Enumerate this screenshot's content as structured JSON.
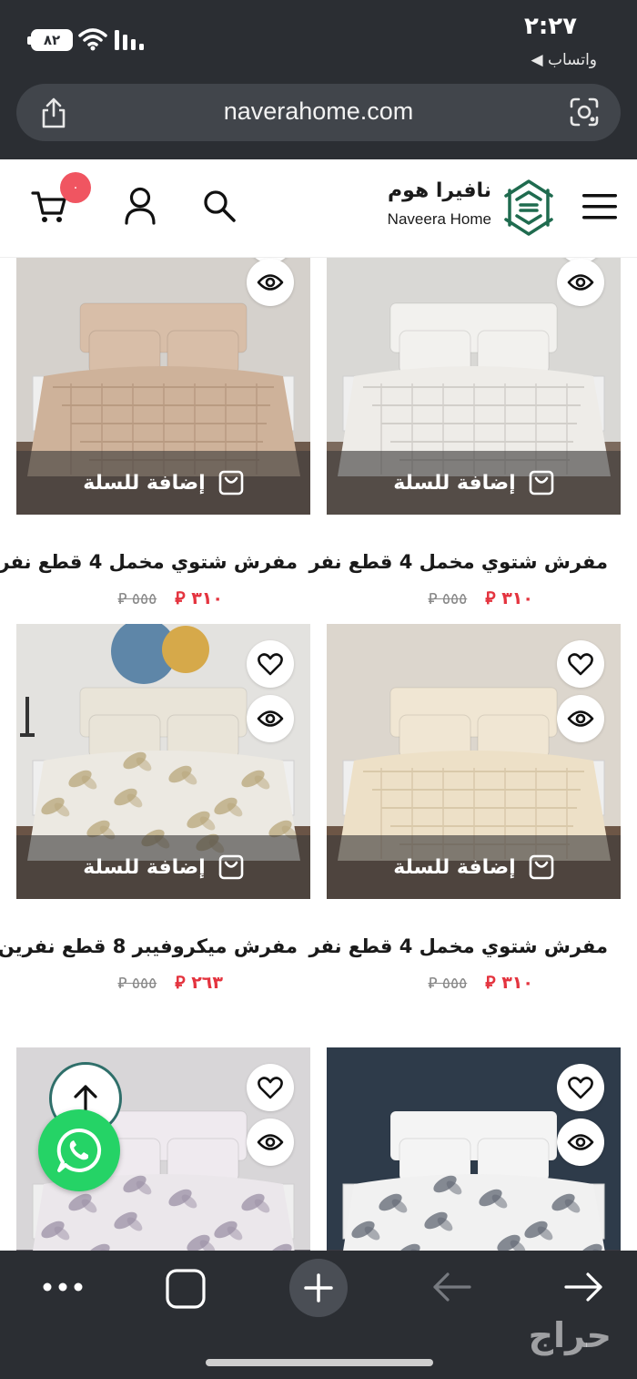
{
  "status_bar": {
    "time": "٢:٢٧",
    "back_app": "◀ واتساب",
    "battery": "٨٢"
  },
  "browser": {
    "url": "naverahome.com"
  },
  "header": {
    "logo_arabic": "نافيرا هوم",
    "logo_english": "Naveera Home",
    "cart_count": "٠"
  },
  "product_actions": {
    "add_to_cart": "إضافة للسلة"
  },
  "products": [
    {
      "title": "مفرش شتوي مخمل 4 قطع نفر",
      "price": "٣١٠ ⃁",
      "old_price": "٥٥٥ ⃁",
      "palette": "cream"
    },
    {
      "title": "مفرش شتوي مخمل 4 قطع نفر",
      "price": "٣١٠ ⃁",
      "old_price": "٥٥٥ ⃁",
      "palette": "tan"
    },
    {
      "title": "مفرش شتوي مخمل 4 قطع نفر",
      "price": "٣١٠ ⃁",
      "old_price": "٥٥٥ ⃁",
      "palette": "beige"
    },
    {
      "title": "مفرش ميكروفيبر 8 قطع نفرين",
      "price": "٢٦٣ ⃁",
      "old_price": "٥٥٥ ⃁",
      "palette": "floral-gold"
    },
    {
      "title": "",
      "price": "",
      "old_price": "",
      "palette": "floral-grey"
    },
    {
      "title": "",
      "price": "",
      "old_price": "",
      "palette": "floral-lilac"
    }
  ],
  "colors": {
    "chrome": "#2b2e33",
    "accent_red": "#e4343f",
    "badge": "#f05561",
    "whatsapp": "#25d366"
  },
  "icons": [
    "share-icon",
    "lens-icon",
    "menu-icon",
    "search-icon",
    "user-icon",
    "cart-icon",
    "heart-icon",
    "eye-icon",
    "bag-icon",
    "arrow-up-icon",
    "whatsapp-icon",
    "more-icon",
    "tabs-icon",
    "plus-icon",
    "back-arrow-icon",
    "forward-arrow-icon"
  ],
  "watermark": "حراج"
}
